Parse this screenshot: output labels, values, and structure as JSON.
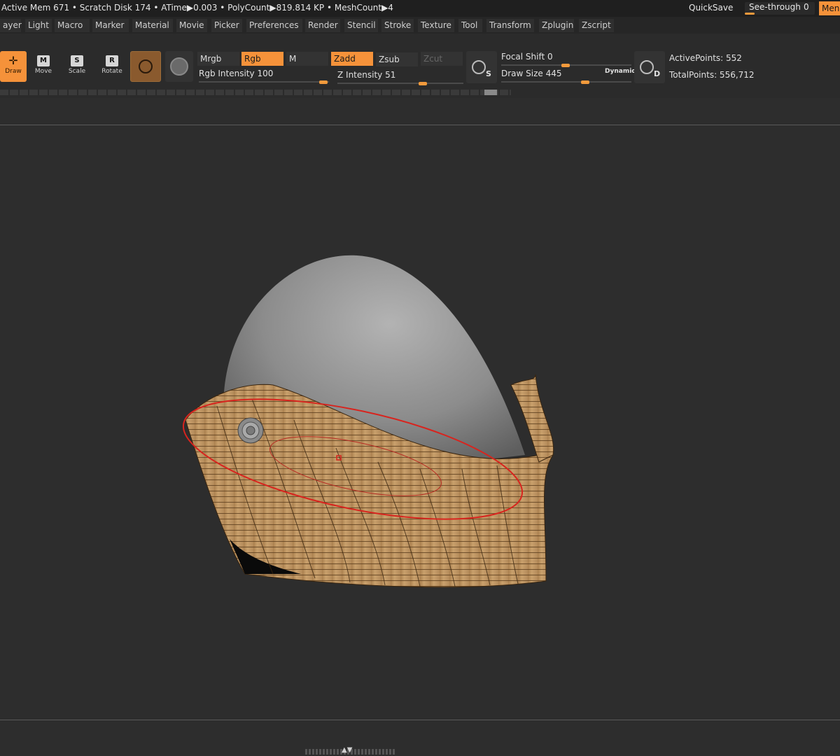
{
  "status": {
    "text": "Active Mem 671 • Scratch Disk 174 •  ATime▶0.003 • PolyCount▶819.814 KP  • MeshCount▶4",
    "quicksave": "QuickSave",
    "see_through_label": "See-through",
    "see_through_value": "0",
    "menu_label": "Men"
  },
  "menubar": {
    "items": [
      "ayer",
      "Light",
      "Macro",
      "Marker",
      "Material",
      "Movie",
      "Picker",
      "Preferences",
      "Render",
      "Stencil",
      "Stroke",
      "Texture",
      "Tool",
      "Transform",
      "Zplugin",
      "Zscript"
    ]
  },
  "toolbar": {
    "draw": "Draw",
    "move": "Move",
    "scale": "Scale",
    "rotate": "Rotate",
    "move_key": "M",
    "scale_key": "S",
    "rotate_key": "R",
    "mrgb": "Mrgb",
    "rgb": "Rgb",
    "m": "M",
    "zadd": "Zadd",
    "zsub": "Zsub",
    "zcut": "Zcut",
    "rgb_intensity_label": "Rgb Intensity",
    "rgb_intensity_value": "100",
    "rgb_intensity_fraction": 1.0,
    "z_intensity_label": "Z Intensity",
    "z_intensity_value": "51",
    "z_intensity_fraction": 0.51,
    "focal_shift_label": "Focal Shift",
    "focal_shift_value": "0",
    "draw_size_label": "Draw Size",
    "draw_size_value": "445",
    "dynamic_label": "Dynamic",
    "sym_s": "S",
    "sym_d": "D",
    "active_points": "ActivePoints: 552",
    "total_points": "TotalPoints: 556,712"
  },
  "colors": {
    "accent": "#f5923a",
    "background": "#2d2d2d",
    "wood": "#c9a06c",
    "cursor_ring": "#d8241e"
  }
}
